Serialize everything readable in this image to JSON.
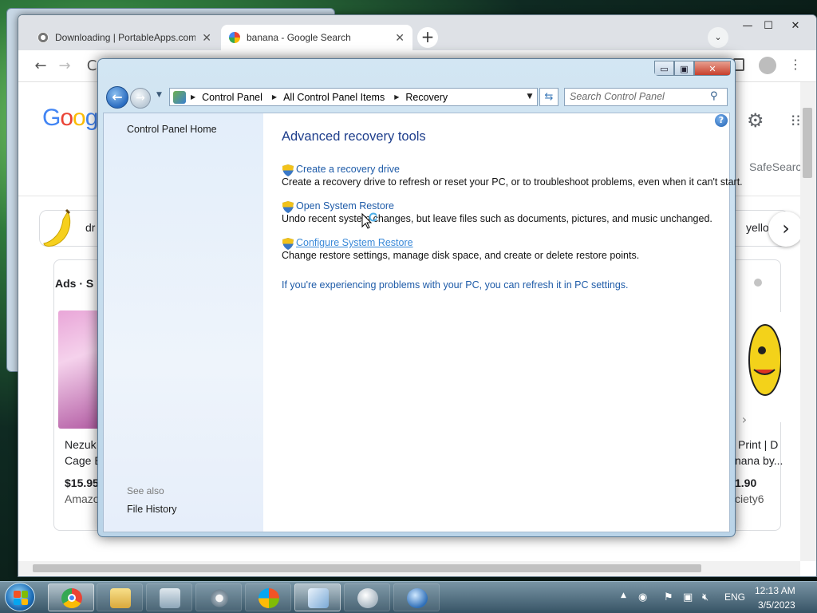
{
  "chrome": {
    "tabs": [
      {
        "label": "Downloading | PortableApps.com",
        "close": "✕"
      },
      {
        "label": "banana - Google Search",
        "close": "✕"
      }
    ],
    "new_tab": "+",
    "tab_menu": "⌄",
    "window_controls": {
      "minimize": "—",
      "maximize": "☐",
      "close": "✕"
    },
    "nav": {
      "back": "←",
      "forward": "→",
      "reload": "C"
    },
    "google": {
      "letters": [
        "G",
        "o",
        "o",
        "g"
      ]
    },
    "safesearch": "SafeSearch",
    "chips": {
      "left_partial": "dr",
      "right_partial": "yello",
      "next": "›"
    },
    "ads": {
      "label": "Ads · S",
      "products": [
        {
          "title_line1": "Nezuk",
          "title_line2": "Cage B",
          "price": "$15.95",
          "store": "Amazo"
        },
        {
          "title_line1": "Print | D",
          "title_line2": "nana by...",
          "price": "1.90",
          "store": "ciety6"
        }
      ]
    }
  },
  "control_panel": {
    "window_controls": {
      "minimize": "▭",
      "maximize": "▣",
      "close": "✕"
    },
    "breadcrumb": [
      "Control Panel",
      "All Control Panel Items",
      "Recovery"
    ],
    "search_placeholder": "Search Control Panel",
    "help": "?",
    "sidebar": {
      "home": "Control Panel Home",
      "see_also_label": "See also",
      "see_also_items": [
        "File History"
      ]
    },
    "heading": "Advanced recovery tools",
    "tools": [
      {
        "link": "Create a recovery drive",
        "description": "Create a recovery drive to refresh or reset your PC, or to troubleshoot problems, even when it can't start."
      },
      {
        "link": "Open System Restore",
        "description": "Undo recent system changes, but leave files such as documents, pictures, and music unchanged."
      },
      {
        "link": "Configure System Restore",
        "description": "Change restore settings, manage disk space, and create or delete restore points."
      }
    ],
    "refresh_link": "If you're experiencing problems with your PC, you can refresh it in PC settings."
  },
  "taskbar": {
    "language": "ENG",
    "time": "12:13 AM",
    "date": "3/5/2023",
    "icons": [
      "chrome-icon",
      "file-explorer-icon",
      "task-manager-icon",
      "settings-gear-icon",
      "windows-update-icon",
      "control-panel-icon",
      "portableapps-icon",
      "network-globe-icon"
    ]
  },
  "colors": {
    "cp_link": "#1e5ba8",
    "cp_heading": "#1e3e8c",
    "chrome_tabstrip": "#dee1e6"
  }
}
